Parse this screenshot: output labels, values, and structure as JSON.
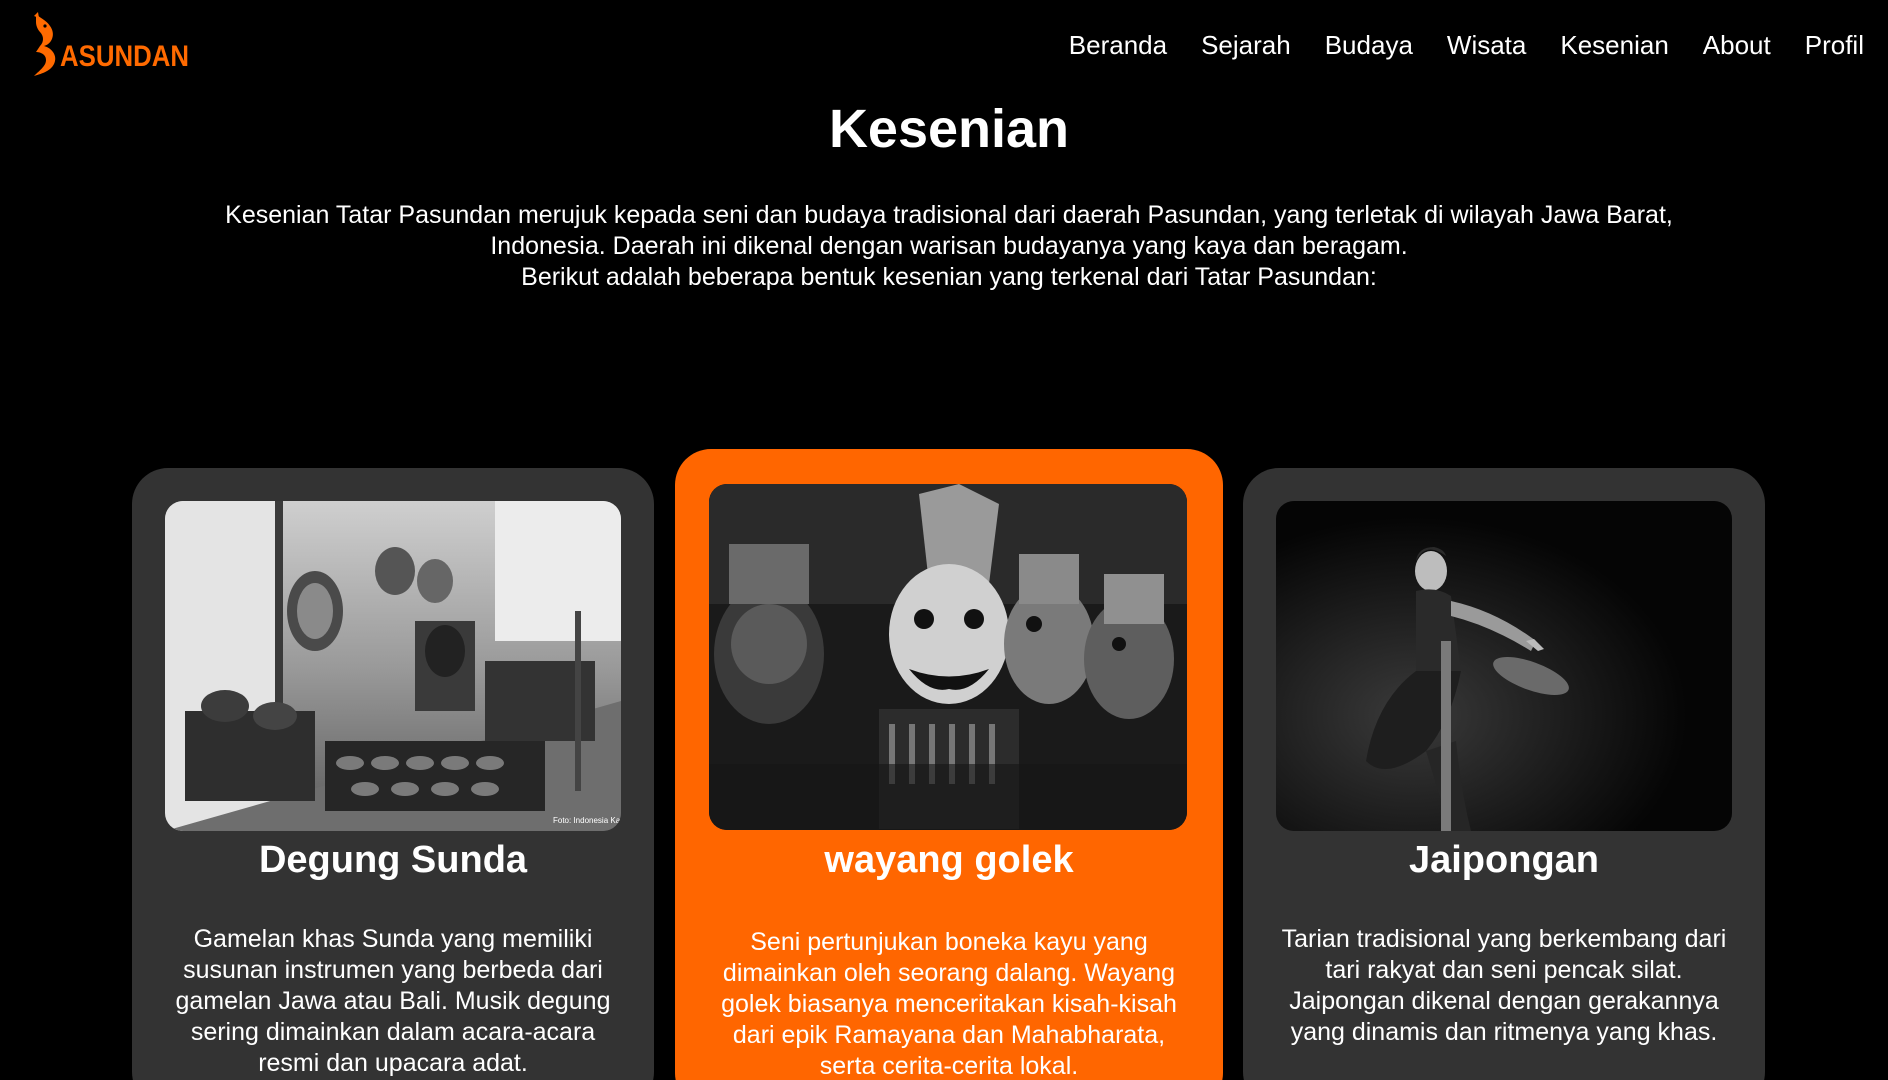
{
  "brand": {
    "logo_text": "ASUNDAN",
    "logo_icon": "orange-serpent-p-icon",
    "accent_color": "#ff6600"
  },
  "nav": {
    "items": [
      {
        "label": "Beranda"
      },
      {
        "label": "Sejarah"
      },
      {
        "label": "Budaya"
      },
      {
        "label": "Wisata"
      },
      {
        "label": "Kesenian"
      },
      {
        "label": "About"
      },
      {
        "label": "Profil"
      }
    ]
  },
  "main": {
    "title": "Kesenian",
    "intro": {
      "line1": "Kesenian Tatar Pasundan merujuk kepada seni dan budaya tradisional dari daerah Pasundan, yang terletak di wilayah Jawa Barat,",
      "line2": "Indonesia. Daerah ini dikenal dengan warisan budayanya yang kaya dan beragam.",
      "line3": "Berikut adalah beberapa bentuk kesenian yang terkenal dari Tatar Pasundan:"
    }
  },
  "cards": [
    {
      "title": "Degung Sunda",
      "description": "Gamelan khas Sunda yang memiliki susunan instrumen yang berbeda dari gamelan Jawa atau Bali. Musik degung sering dimainkan dalam acara-acara resmi dan upacara adat.",
      "image_watermark": "Foto: Indonesia Kaya",
      "background_color": "#333333"
    },
    {
      "title": "wayang golek",
      "description": "Seni pertunjukan boneka kayu yang dimainkan oleh seorang dalang. Wayang golek biasanya menceritakan kisah-kisah dari epik Ramayana dan Mahabharata, serta cerita-cerita lokal.",
      "background_color": "#ff6600"
    },
    {
      "title": "Jaipongan",
      "description": "Tarian tradisional yang berkembang dari tari rakyat dan seni pencak silat. Jaipongan dikenal dengan gerakannya yang dinamis dan ritmenya yang khas.",
      "background_color": "#333333"
    }
  ]
}
